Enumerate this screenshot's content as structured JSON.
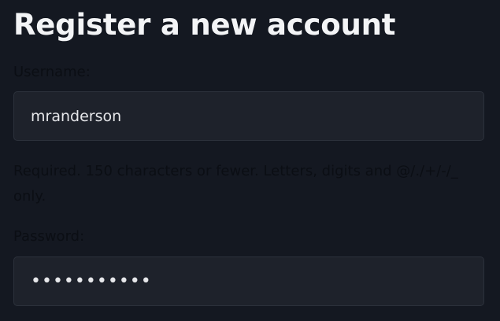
{
  "form": {
    "title": "Register a new account",
    "username": {
      "label": "Username:",
      "value": "mranderson",
      "help": "Required. 150 characters or fewer. Letters, digits and @/./+/-/_ only."
    },
    "password": {
      "label": "Password:",
      "value": "mranderson1"
    }
  }
}
